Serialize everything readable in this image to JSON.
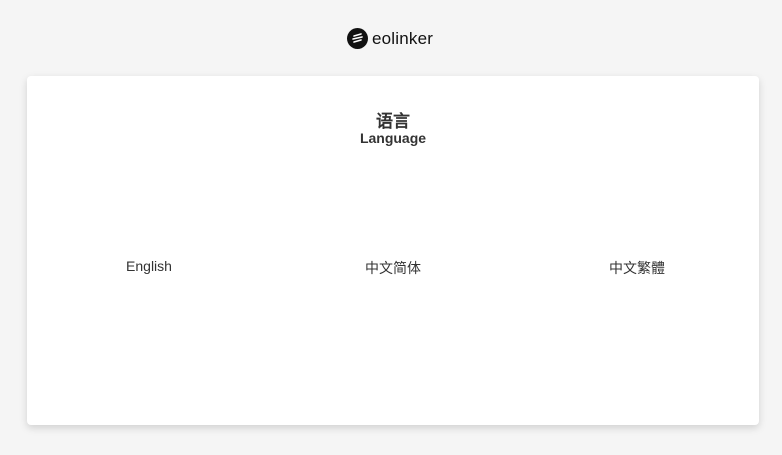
{
  "brand": {
    "name": "eolinker"
  },
  "card": {
    "title": "语言",
    "subtitle": "Language"
  },
  "languages": [
    {
      "label": "English"
    },
    {
      "label": "中文简体"
    },
    {
      "label": "中文繁體"
    }
  ]
}
